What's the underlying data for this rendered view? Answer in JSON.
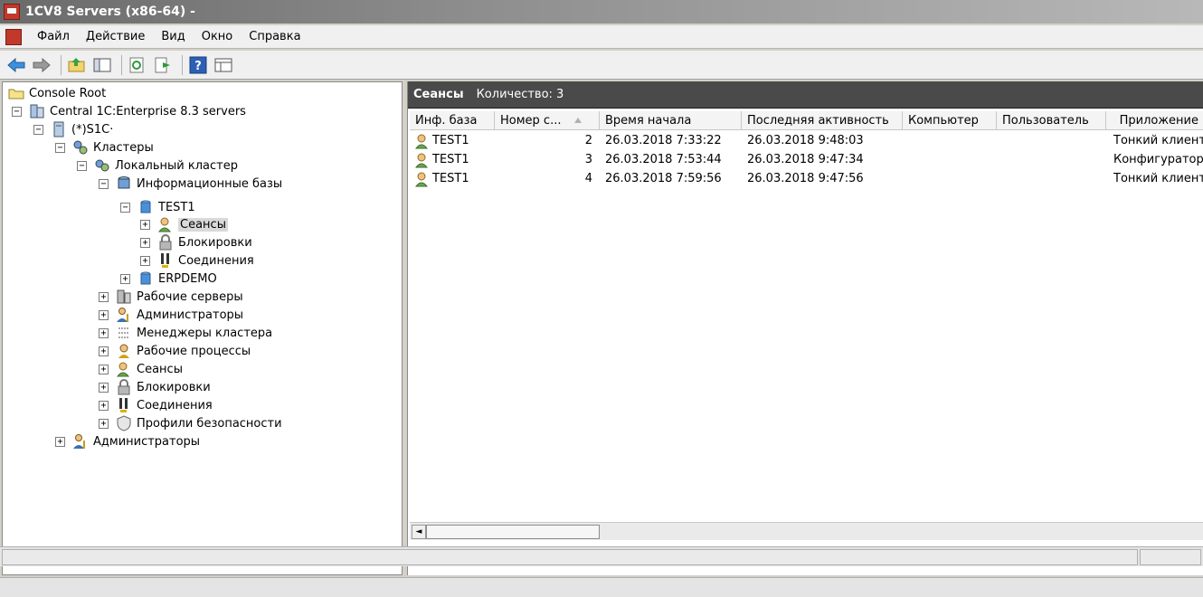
{
  "window": {
    "title": "1CV8 Servers (x86-64) -"
  },
  "menu": [
    "Файл",
    "Действие",
    "Вид",
    "Окно",
    "Справка"
  ],
  "toolbar": {
    "icons": [
      "back-arrow-icon",
      "forward-arrow-icon",
      "up-folder-icon",
      "show-hide-tree-icon",
      "refresh-icon",
      "export-list-icon",
      "help-icon",
      "properties-icon"
    ]
  },
  "tree": [
    {
      "label": "Console Root",
      "icon": "folder-icon",
      "expander": ""
    },
    {
      "label": "Central 1C:Enterprise 8.3 servers",
      "icon": "servers-icon",
      "expander": "−"
    },
    {
      "label": "(*)S1C·",
      "icon": "server-icon",
      "expander": "−"
    },
    {
      "label": "Кластеры",
      "icon": "clusters-icon",
      "expander": "−"
    },
    {
      "label": "Локальный кластер",
      "icon": "cluster-icon",
      "expander": "−"
    },
    {
      "label": "Информационные базы",
      "icon": "infobases-icon",
      "expander": "−"
    },
    {
      "label": "TEST1",
      "icon": "database-icon",
      "expander": "−"
    },
    {
      "label": "Сеансы",
      "icon": "sessions-icon",
      "expander": "+",
      "selected": true
    },
    {
      "label": "Блокировки",
      "icon": "locks-icon",
      "expander": "+"
    },
    {
      "label": "Соединения",
      "icon": "connections-icon",
      "expander": "+"
    },
    {
      "label": "ERPDEMO",
      "icon": "database-icon",
      "expander": "+"
    },
    {
      "label": "Рабочие серверы",
      "icon": "work-servers-icon",
      "expander": "+"
    },
    {
      "label": "Администраторы",
      "icon": "administrators-icon",
      "expander": "+"
    },
    {
      "label": "Менеджеры кластера",
      "icon": "cluster-managers-icon",
      "expander": "+"
    },
    {
      "label": "Рабочие процессы",
      "icon": "work-processes-icon",
      "expander": "+"
    },
    {
      "label": "Сеансы",
      "icon": "sessions-icon",
      "expander": "+"
    },
    {
      "label": "Блокировки",
      "icon": "locks-icon",
      "expander": "+"
    },
    {
      "label": "Соединения",
      "icon": "connections-icon",
      "expander": "+"
    },
    {
      "label": "Профили безопасности",
      "icon": "security-profiles-icon",
      "expander": "+"
    },
    {
      "label": "Администраторы",
      "icon": "administrators-icon",
      "expander": "+"
    }
  ],
  "panel": {
    "title": "Сеансы",
    "count": "Количество: 3"
  },
  "table": {
    "columns": [
      "Инф. база",
      "Номер с...",
      "Время начала",
      "Последняя активность",
      "Компьютер",
      "Пользователь",
      "Приложение"
    ],
    "rows": [
      {
        "infobase": "TEST1",
        "number": "2",
        "start": "26.03.2018 7:33:22",
        "last": "26.03.2018 9:48:03",
        "computer": "",
        "user": "",
        "app": "Тонкий клиент"
      },
      {
        "infobase": "TEST1",
        "number": "3",
        "start": "26.03.2018 7:53:44",
        "last": "26.03.2018 9:47:34",
        "computer": "",
        "user": "",
        "app": "Конфигуратор"
      },
      {
        "infobase": "TEST1",
        "number": "4",
        "start": "26.03.2018 7:59:56",
        "last": "26.03.2018 9:47:56",
        "computer": "",
        "user": "",
        "app": "Тонкий клиент"
      }
    ]
  }
}
